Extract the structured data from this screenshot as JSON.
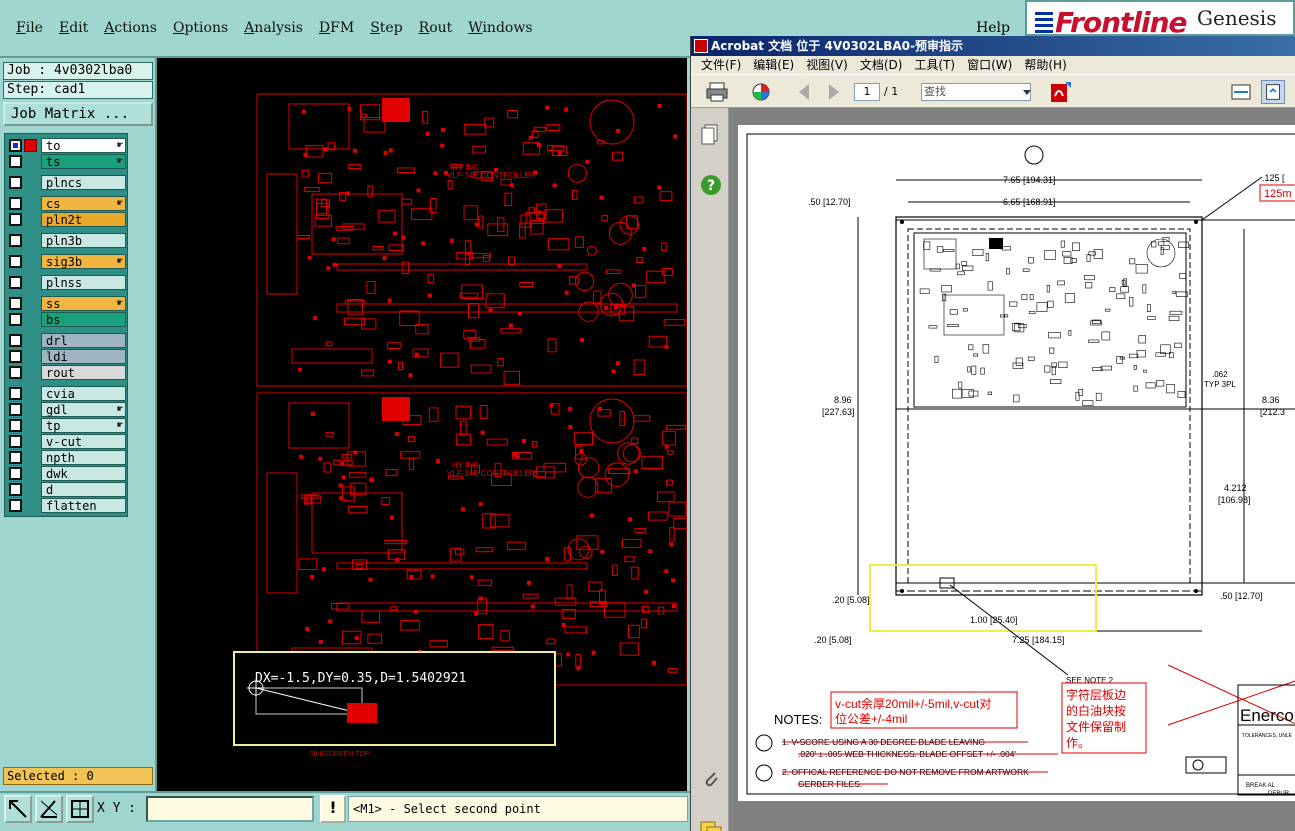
{
  "menu": {
    "items": [
      "File",
      "Edit",
      "Actions",
      "Options",
      "Analysis",
      "DFM",
      "Step",
      "Rout",
      "Windows"
    ],
    "help": "Help"
  },
  "brand": {
    "logo": "Frontline",
    "product": "Genesis 2"
  },
  "job": {
    "job_label": "Job : 4v0302lba0",
    "step_label": "Step: cad1",
    "matrix_button": "Job Matrix ..."
  },
  "layers": [
    {
      "name": "to",
      "color": "white",
      "checked": true,
      "red": true,
      "hand": true
    },
    {
      "name": "ts",
      "color": "green",
      "checked": false,
      "hand": true
    },
    {
      "name": "plncs",
      "color": "default",
      "checked": false
    },
    {
      "name": "cs",
      "color": "orange",
      "checked": false,
      "hand": true
    },
    {
      "name": "pln2t",
      "color": "gold",
      "checked": false
    },
    {
      "name": "pln3b",
      "color": "default",
      "checked": false
    },
    {
      "name": "sig3b",
      "color": "orange",
      "checked": false,
      "hand": true
    },
    {
      "name": "plnss",
      "color": "default",
      "checked": false
    },
    {
      "name": "ss",
      "color": "orange",
      "checked": false,
      "hand": true
    },
    {
      "name": "bs",
      "color": "green",
      "checked": false
    },
    {
      "name": "drl",
      "color": "gray",
      "checked": false
    },
    {
      "name": "ldi",
      "color": "gray",
      "checked": false
    },
    {
      "name": "rout",
      "color": "lgray",
      "checked": false
    },
    {
      "name": "cvia",
      "color": "default",
      "checked": false
    },
    {
      "name": "gdl",
      "color": "default",
      "checked": false,
      "hand": true
    },
    {
      "name": "tp",
      "color": "default",
      "checked": false,
      "hand": true
    },
    {
      "name": "v-cut",
      "color": "default",
      "checked": false
    },
    {
      "name": "npth",
      "color": "default",
      "checked": false
    },
    {
      "name": "dwk",
      "color": "default",
      "checked": false
    },
    {
      "name": "d",
      "color": "default",
      "checked": false
    },
    {
      "name": "flatten",
      "color": "default",
      "checked": false
    }
  ],
  "selected": "Selected : 0",
  "canvas": {
    "measure": "DX=-1.5,DY=0.35,D=1.5402921",
    "silk_label": "SILKSCREEN TOP",
    "board_text_1": "HY INC.",
    "board_text_2": "VLF-34E CONTROLLER"
  },
  "bottom": {
    "xy_label": "X Y :",
    "xy_value": "",
    "warn": "!",
    "status": "<M1> - Select second point"
  },
  "acrobat": {
    "title": "Acrobat 文档 位于 4V0302LBA0-预审指示",
    "menus": [
      "文件(F)",
      "编辑(E)",
      "视图(V)",
      "文档(D)",
      "工具(T)",
      "窗口(W)",
      "帮助(H)"
    ],
    "page_current": "1",
    "page_total": "/ 1",
    "find_placeholder": "查找",
    "drawing": {
      "dim_top_outer": "7.65 [194.31]",
      "dim_top_inner": "6.65 [168.91]",
      "dim_left_50": ".50 [12.70]",
      "dim_right_125": ".125 [",
      "note_125": "125m",
      "dim_height": "8.96",
      "dim_height_mm": "[227.63]",
      "dim_height2": "8.36",
      "dim_height2_mm": "[212.3",
      "typ": ".062",
      "typ2": "TYP 3PL",
      "dim_4212": "4.212",
      "dim_4212_mm": "[106.98]",
      "dim_20a": ".20 [5.08]",
      "dim_100": "1.00 [25.40]",
      "dim_50r": ".50 [12.70]",
      "dim_20b": ".20 [5.08]",
      "dim_725": "7.25 [184.15]",
      "see_note": "SEE NOTE 2",
      "red_note_1a": "v-cut余厚20mil+/-5mil,v-cut对",
      "red_note_1b": "位公差+/-4mil",
      "red_note_2a": "字符层板边",
      "red_note_2b": "的白油块按",
      "red_note_2c": "文件保留制",
      "red_note_2d": "作。",
      "notes_title": "NOTES:",
      "note1a": "1.  V-SCORE USING A 30 DEGREE BLADE LEAVING",
      "note1b": ".020' ± .005 WEB THICKNESS.  BLADE OFFSET +/- .004'",
      "note2a": "2.  OFFICAL REFERENCE DO NOT REMOVE FROM ARTWORK",
      "note2b": "GERBER FILES.",
      "tb_logo": "Enerco",
      "tb_text1": "TOLERANCES, UNLE",
      "tb_text2": "BREAK  AL",
      "tb_text3": "DEBUR"
    }
  }
}
